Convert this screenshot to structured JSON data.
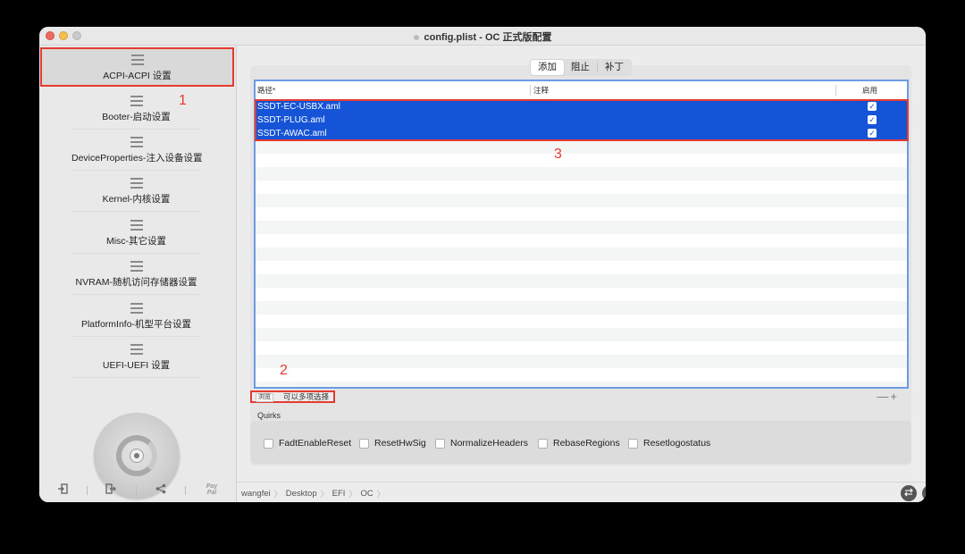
{
  "window": {
    "title": "config.plist - OC 正式版配置"
  },
  "sidebar": {
    "items": [
      {
        "label": "ACPI-ACPI 设置",
        "active": true
      },
      {
        "label": "Booter-启动设置"
      },
      {
        "label": "DeviceProperties-注入设备设置"
      },
      {
        "label": "Kernel-内核设置"
      },
      {
        "label": "Misc-其它设置"
      },
      {
        "label": "NVRAM-随机访问存储器设置"
      },
      {
        "label": "PlatformInfo-机型平台设置"
      },
      {
        "label": "UEFI-UEFI 设置"
      }
    ],
    "bottom_buttons": {
      "import_icon": "import-icon",
      "export_icon": "export-icon",
      "share_icon": "share-icon",
      "paypal_line1": "Pay",
      "paypal_line2": "Pal"
    }
  },
  "tabs": [
    {
      "label": "添加",
      "active": true
    },
    {
      "label": "阻止"
    },
    {
      "label": "补丁"
    }
  ],
  "table": {
    "headers": {
      "path": "路径*",
      "comment": "注释",
      "enabled": "启用"
    },
    "rows": [
      {
        "path": "SSDT-EC-USBX.aml",
        "comment": "",
        "enabled": true
      },
      {
        "path": "SSDT-PLUG.aml",
        "comment": "",
        "enabled": true
      },
      {
        "path": "SSDT-AWAC.aml",
        "comment": "",
        "enabled": true
      }
    ],
    "empty_rows": 19
  },
  "annotations": {
    "m1": "1",
    "m2": "2",
    "m3": "3"
  },
  "below_table": {
    "browse_label": "浏览",
    "multi_select_label": "可以多项选择",
    "add_remove": "—+"
  },
  "quirks": {
    "title": "Quirks",
    "items": [
      {
        "label": "FadtEnableReset",
        "checked": false
      },
      {
        "label": "ResetHwSig",
        "checked": false
      },
      {
        "label": "NormalizeHeaders",
        "checked": false
      },
      {
        "label": "RebaseRegions",
        "checked": false
      },
      {
        "label": "Resetlogostatus",
        "checked": false
      }
    ]
  },
  "statusbar": {
    "breadcrumbs": [
      "wangfei",
      "Desktop",
      "EFI",
      "OC"
    ],
    "breadcrumb_separator": "〉",
    "right_icons": [
      "swap-icon",
      "list-icon"
    ]
  },
  "colors": {
    "selection": "#1554d6",
    "annotation": "#e53a2f",
    "table_border": "#6b9be3"
  }
}
